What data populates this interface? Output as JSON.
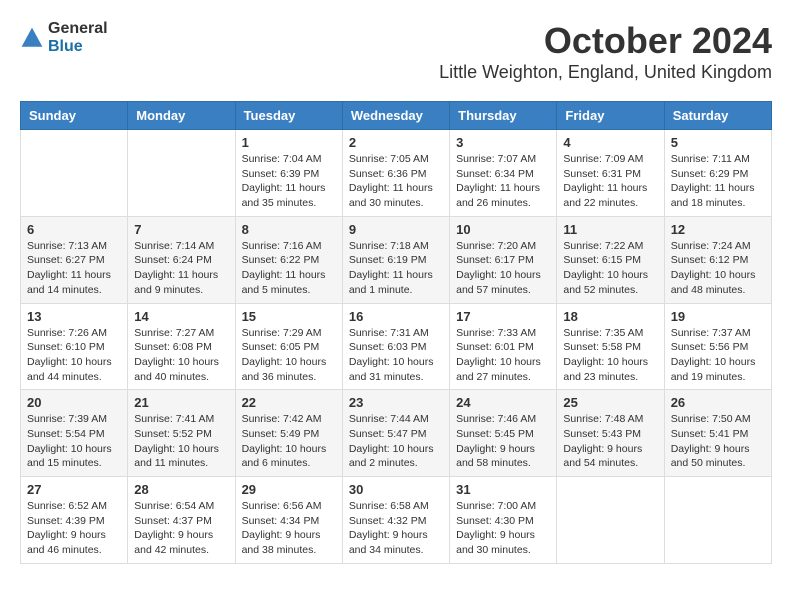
{
  "logo": {
    "general": "General",
    "blue": "Blue"
  },
  "title": "October 2024",
  "location": "Little Weighton, England, United Kingdom",
  "days_of_week": [
    "Sunday",
    "Monday",
    "Tuesday",
    "Wednesday",
    "Thursday",
    "Friday",
    "Saturday"
  ],
  "weeks": [
    [
      {
        "day": "",
        "sunrise": "",
        "sunset": "",
        "daylight": ""
      },
      {
        "day": "",
        "sunrise": "",
        "sunset": "",
        "daylight": ""
      },
      {
        "day": "1",
        "sunrise": "Sunrise: 7:04 AM",
        "sunset": "Sunset: 6:39 PM",
        "daylight": "Daylight: 11 hours and 35 minutes."
      },
      {
        "day": "2",
        "sunrise": "Sunrise: 7:05 AM",
        "sunset": "Sunset: 6:36 PM",
        "daylight": "Daylight: 11 hours and 30 minutes."
      },
      {
        "day": "3",
        "sunrise": "Sunrise: 7:07 AM",
        "sunset": "Sunset: 6:34 PM",
        "daylight": "Daylight: 11 hours and 26 minutes."
      },
      {
        "day": "4",
        "sunrise": "Sunrise: 7:09 AM",
        "sunset": "Sunset: 6:31 PM",
        "daylight": "Daylight: 11 hours and 22 minutes."
      },
      {
        "day": "5",
        "sunrise": "Sunrise: 7:11 AM",
        "sunset": "Sunset: 6:29 PM",
        "daylight": "Daylight: 11 hours and 18 minutes."
      }
    ],
    [
      {
        "day": "6",
        "sunrise": "Sunrise: 7:13 AM",
        "sunset": "Sunset: 6:27 PM",
        "daylight": "Daylight: 11 hours and 14 minutes."
      },
      {
        "day": "7",
        "sunrise": "Sunrise: 7:14 AM",
        "sunset": "Sunset: 6:24 PM",
        "daylight": "Daylight: 11 hours and 9 minutes."
      },
      {
        "day": "8",
        "sunrise": "Sunrise: 7:16 AM",
        "sunset": "Sunset: 6:22 PM",
        "daylight": "Daylight: 11 hours and 5 minutes."
      },
      {
        "day": "9",
        "sunrise": "Sunrise: 7:18 AM",
        "sunset": "Sunset: 6:19 PM",
        "daylight": "Daylight: 11 hours and 1 minute."
      },
      {
        "day": "10",
        "sunrise": "Sunrise: 7:20 AM",
        "sunset": "Sunset: 6:17 PM",
        "daylight": "Daylight: 10 hours and 57 minutes."
      },
      {
        "day": "11",
        "sunrise": "Sunrise: 7:22 AM",
        "sunset": "Sunset: 6:15 PM",
        "daylight": "Daylight: 10 hours and 52 minutes."
      },
      {
        "day": "12",
        "sunrise": "Sunrise: 7:24 AM",
        "sunset": "Sunset: 6:12 PM",
        "daylight": "Daylight: 10 hours and 48 minutes."
      }
    ],
    [
      {
        "day": "13",
        "sunrise": "Sunrise: 7:26 AM",
        "sunset": "Sunset: 6:10 PM",
        "daylight": "Daylight: 10 hours and 44 minutes."
      },
      {
        "day": "14",
        "sunrise": "Sunrise: 7:27 AM",
        "sunset": "Sunset: 6:08 PM",
        "daylight": "Daylight: 10 hours and 40 minutes."
      },
      {
        "day": "15",
        "sunrise": "Sunrise: 7:29 AM",
        "sunset": "Sunset: 6:05 PM",
        "daylight": "Daylight: 10 hours and 36 minutes."
      },
      {
        "day": "16",
        "sunrise": "Sunrise: 7:31 AM",
        "sunset": "Sunset: 6:03 PM",
        "daylight": "Daylight: 10 hours and 31 minutes."
      },
      {
        "day": "17",
        "sunrise": "Sunrise: 7:33 AM",
        "sunset": "Sunset: 6:01 PM",
        "daylight": "Daylight: 10 hours and 27 minutes."
      },
      {
        "day": "18",
        "sunrise": "Sunrise: 7:35 AM",
        "sunset": "Sunset: 5:58 PM",
        "daylight": "Daylight: 10 hours and 23 minutes."
      },
      {
        "day": "19",
        "sunrise": "Sunrise: 7:37 AM",
        "sunset": "Sunset: 5:56 PM",
        "daylight": "Daylight: 10 hours and 19 minutes."
      }
    ],
    [
      {
        "day": "20",
        "sunrise": "Sunrise: 7:39 AM",
        "sunset": "Sunset: 5:54 PM",
        "daylight": "Daylight: 10 hours and 15 minutes."
      },
      {
        "day": "21",
        "sunrise": "Sunrise: 7:41 AM",
        "sunset": "Sunset: 5:52 PM",
        "daylight": "Daylight: 10 hours and 11 minutes."
      },
      {
        "day": "22",
        "sunrise": "Sunrise: 7:42 AM",
        "sunset": "Sunset: 5:49 PM",
        "daylight": "Daylight: 10 hours and 6 minutes."
      },
      {
        "day": "23",
        "sunrise": "Sunrise: 7:44 AM",
        "sunset": "Sunset: 5:47 PM",
        "daylight": "Daylight: 10 hours and 2 minutes."
      },
      {
        "day": "24",
        "sunrise": "Sunrise: 7:46 AM",
        "sunset": "Sunset: 5:45 PM",
        "daylight": "Daylight: 9 hours and 58 minutes."
      },
      {
        "day": "25",
        "sunrise": "Sunrise: 7:48 AM",
        "sunset": "Sunset: 5:43 PM",
        "daylight": "Daylight: 9 hours and 54 minutes."
      },
      {
        "day": "26",
        "sunrise": "Sunrise: 7:50 AM",
        "sunset": "Sunset: 5:41 PM",
        "daylight": "Daylight: 9 hours and 50 minutes."
      }
    ],
    [
      {
        "day": "27",
        "sunrise": "Sunrise: 6:52 AM",
        "sunset": "Sunset: 4:39 PM",
        "daylight": "Daylight: 9 hours and 46 minutes."
      },
      {
        "day": "28",
        "sunrise": "Sunrise: 6:54 AM",
        "sunset": "Sunset: 4:37 PM",
        "daylight": "Daylight: 9 hours and 42 minutes."
      },
      {
        "day": "29",
        "sunrise": "Sunrise: 6:56 AM",
        "sunset": "Sunset: 4:34 PM",
        "daylight": "Daylight: 9 hours and 38 minutes."
      },
      {
        "day": "30",
        "sunrise": "Sunrise: 6:58 AM",
        "sunset": "Sunset: 4:32 PM",
        "daylight": "Daylight: 9 hours and 34 minutes."
      },
      {
        "day": "31",
        "sunrise": "Sunrise: 7:00 AM",
        "sunset": "Sunset: 4:30 PM",
        "daylight": "Daylight: 9 hours and 30 minutes."
      },
      {
        "day": "",
        "sunrise": "",
        "sunset": "",
        "daylight": ""
      },
      {
        "day": "",
        "sunrise": "",
        "sunset": "",
        "daylight": ""
      }
    ]
  ]
}
